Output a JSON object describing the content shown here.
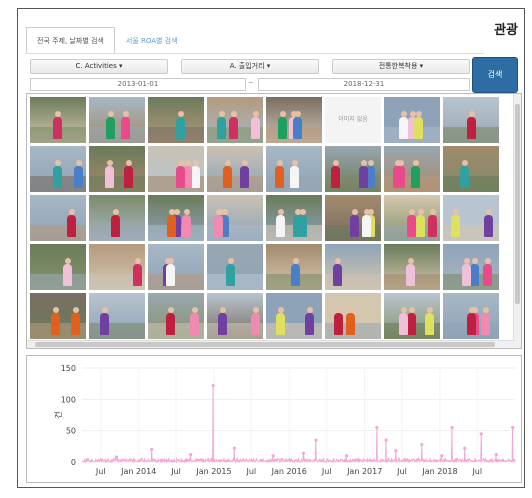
{
  "header": {
    "corner_title": "관광"
  },
  "tabs": [
    {
      "label": "전국 주제, 날짜별 검색",
      "active": true
    },
    {
      "label": "서울 ROA별 검색",
      "active": false
    }
  ],
  "filters": {
    "dropdowns": [
      {
        "label": "C. Activities ▾"
      },
      {
        "label": "A. 출입거리 ▾"
      },
      {
        "label": "전통한복착용 ▾"
      }
    ],
    "start_date": "2013-01-01",
    "end_date": "2018-12-31",
    "date_separator": "~",
    "search_label": "검색"
  },
  "gallery": {
    "no_image_label": "이미지 없음",
    "rows": 5,
    "cols": 8
  },
  "chart_data": {
    "type": "line",
    "title": "",
    "xlabel": "",
    "ylabel": "건",
    "ylim": [
      0,
      150
    ],
    "yticks": [
      0,
      50,
      100,
      150
    ],
    "xtick_labels": [
      "Jul",
      "Jan 2014",
      "Jul",
      "Jan 2015",
      "Jul",
      "Jan 2016",
      "Jul",
      "Jan 2017",
      "Jul",
      "Jan 2018",
      "Jul"
    ],
    "xlim": [
      "2013-04-01",
      "2018-12-31"
    ],
    "series_color": "#f2a7d8",
    "peaks": [
      {
        "x": "2013-09-15",
        "y": 8
      },
      {
        "x": "2014-03-05",
        "y": 20
      },
      {
        "x": "2014-09-10",
        "y": 12
      },
      {
        "x": "2014-12-28",
        "y": 122
      },
      {
        "x": "2015-04-10",
        "y": 22
      },
      {
        "x": "2015-10-15",
        "y": 10
      },
      {
        "x": "2016-03-10",
        "y": 14
      },
      {
        "x": "2016-05-10",
        "y": 35
      },
      {
        "x": "2016-10-05",
        "y": 10
      },
      {
        "x": "2017-03-01",
        "y": 55
      },
      {
        "x": "2017-04-15",
        "y": 35
      },
      {
        "x": "2017-06-01",
        "y": 18
      },
      {
        "x": "2017-10-05",
        "y": 28
      },
      {
        "x": "2018-01-10",
        "y": 10
      },
      {
        "x": "2018-03-01",
        "y": 55
      },
      {
        "x": "2018-05-01",
        "y": 22
      },
      {
        "x": "2018-07-20",
        "y": 45
      },
      {
        "x": "2018-10-01",
        "y": 12
      },
      {
        "x": "2018-12-20",
        "y": 55
      }
    ]
  }
}
